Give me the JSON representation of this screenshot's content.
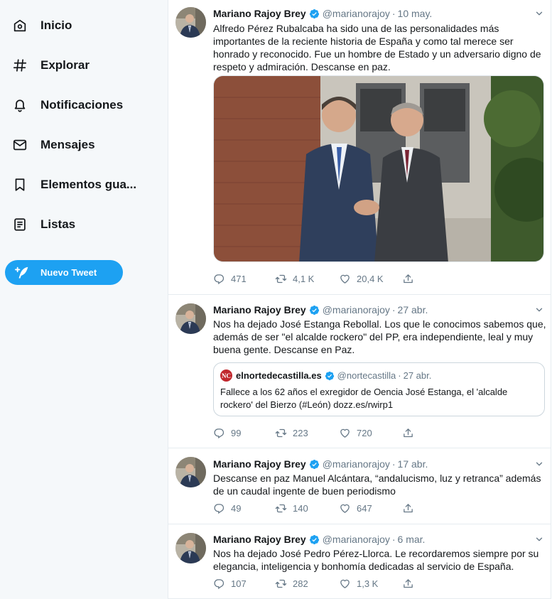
{
  "sidebar": {
    "items": [
      {
        "label": "Inicio",
        "icon": "home-icon"
      },
      {
        "label": "Explorar",
        "icon": "hashtag-icon"
      },
      {
        "label": "Notificaciones",
        "icon": "bell-icon"
      },
      {
        "label": "Mensajes",
        "icon": "mail-icon"
      },
      {
        "label": "Elementos gua...",
        "icon": "bookmark-icon"
      },
      {
        "label": "Listas",
        "icon": "list-icon"
      }
    ],
    "tweet_button": "Nuevo Tweet"
  },
  "colors": {
    "accent": "#1da1f2",
    "verified": "#1da1f2",
    "muted": "#657786",
    "text": "#14171a",
    "sidebar_bg": "#f5f8fa"
  },
  "tweets": [
    {
      "name": "Mariano Rajoy Brey",
      "handle": "@marianorajoy",
      "date": "10 may.",
      "text": "Alfredo Pérez Rubalcaba ha sido una de las personalidades más importantes de la reciente historia de España y como tal merece ser honrado y reconocido. Fue un hombre de Estado y un adversario digno de respeto y admiración. Descanse en paz.",
      "replies": "471",
      "retweets": "4,1 K",
      "likes": "20,4 K"
    },
    {
      "name": "Mariano Rajoy Brey",
      "handle": "@marianorajoy",
      "date": "27 abr.",
      "text": "Nos ha dejado José Estanga Rebollal. Los que le conocimos sabemos que, además de ser \"el alcalde rockero\" del PP, era independiente, leal y muy buena gente. Descanse en Paz.",
      "quote": {
        "logo_text": "NC",
        "name": "elnortedecastilla.es",
        "handle": "@nortecastilla",
        "date": "27 abr.",
        "text": "Fallece a los 62 años el exregidor de Oencia José Estanga, el 'alcalde rockero' del Bierzo (#León) dozz.es/rwirp1"
      },
      "replies": "99",
      "retweets": "223",
      "likes": "720"
    },
    {
      "name": "Mariano Rajoy Brey",
      "handle": "@marianorajoy",
      "date": "17 abr.",
      "text": "Descanse en paz Manuel Alcántara, “andalucismo, luz y retranca” además de un caudal ingente de buen periodismo",
      "replies": "49",
      "retweets": "140",
      "likes": "647"
    },
    {
      "name": "Mariano Rajoy Brey",
      "handle": "@marianorajoy",
      "date": "6 mar.",
      "text": "Nos ha dejado José Pedro Pérez-Llorca. Le recordaremos siempre por su elegancia, inteligencia y bonhomía dedicadas al servicio de España.",
      "replies": "107",
      "retweets": "282",
      "likes": "1,3 K"
    }
  ],
  "separator_dot": "·"
}
